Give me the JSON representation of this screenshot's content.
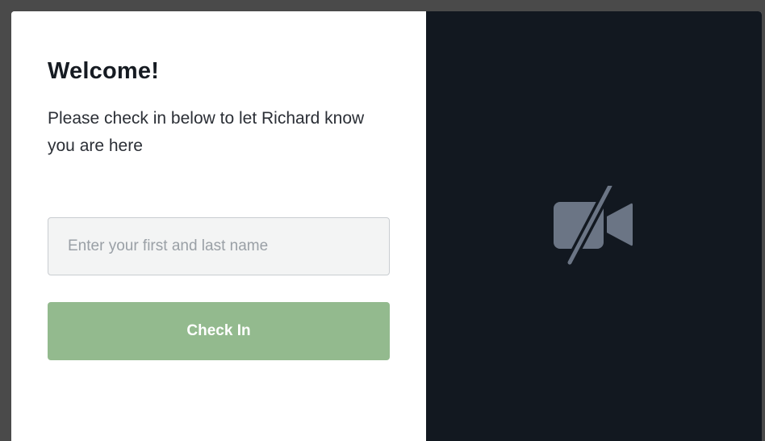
{
  "checkin": {
    "title": "Welcome!",
    "subtitle": "Please check in below to let Richard know you are here",
    "name_input": {
      "value": "",
      "placeholder": "Enter your first and last name"
    },
    "button_label": "Check In"
  },
  "video": {
    "icon": "video-off-icon",
    "background_color": "#121820",
    "icon_color": "#6b7585"
  },
  "colors": {
    "button": "#93ba8e",
    "input_background": "#f3f4f4"
  }
}
